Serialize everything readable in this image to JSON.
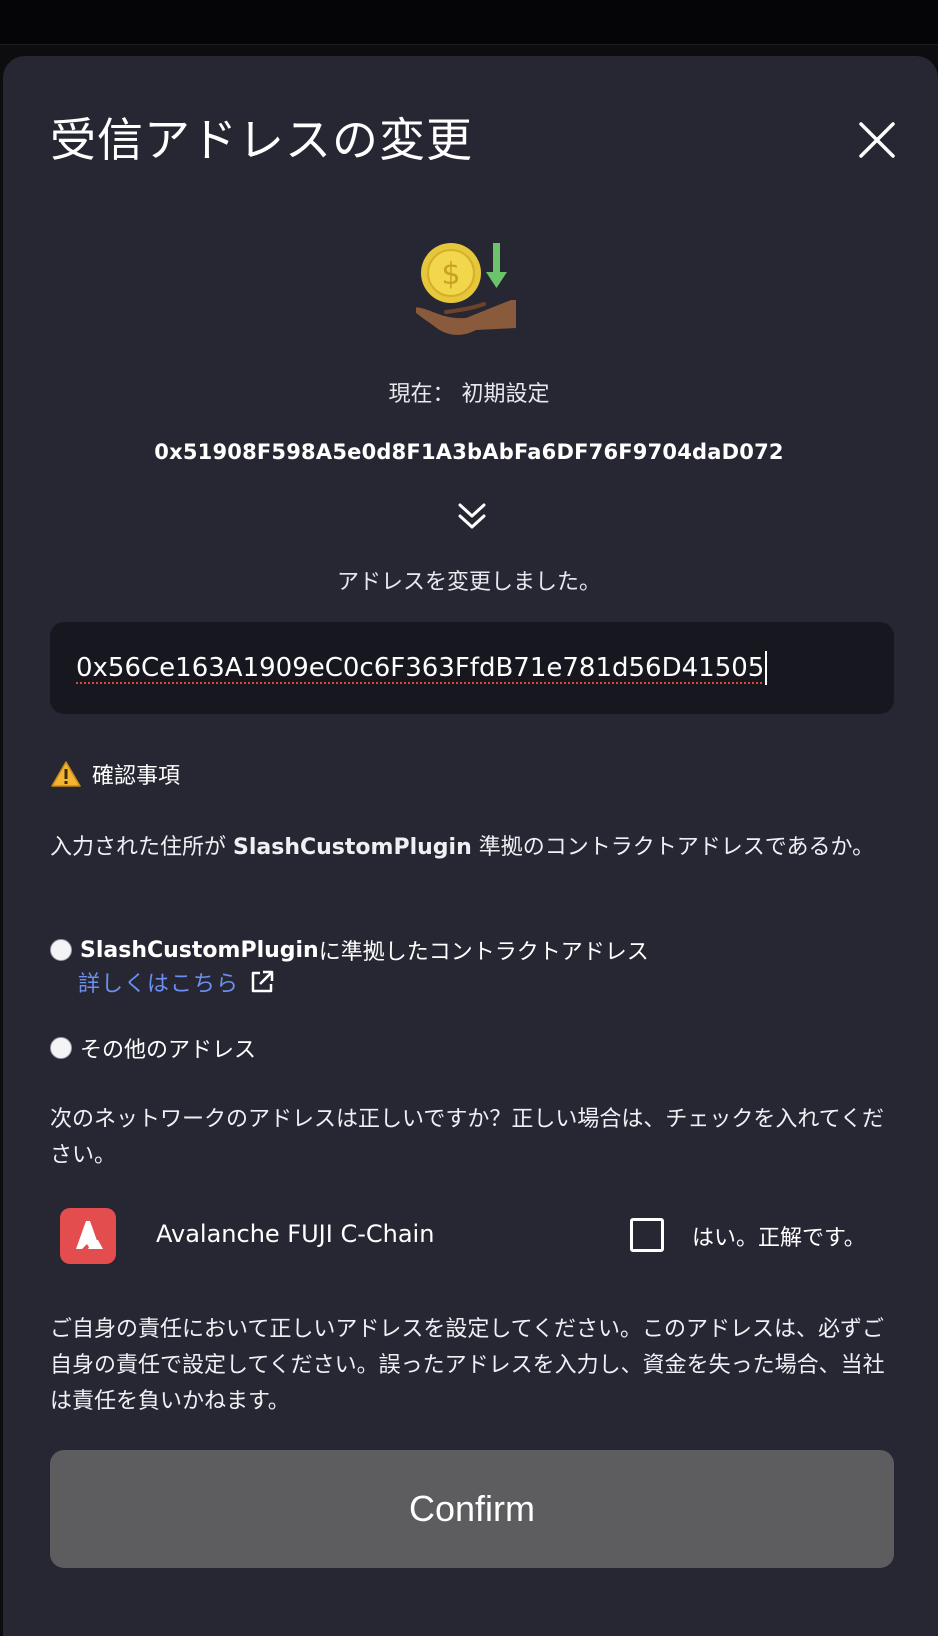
{
  "modal": {
    "title": "受信アドレスの変更",
    "current_label": "現在： 初期設定",
    "current_address": "0x51908F598A5e0d8F1A3bAbFa6DF76F9704daD072",
    "changed_text": "アドレスを変更しました。"
  },
  "address_input": {
    "value": "0x56Ce163A1909eC0c6F363FfdB71e781d56D41505"
  },
  "confirmation": {
    "heading": "確認事項",
    "question_prefix": "入力された住所が",
    "question_brand": "SlashCustomPlugin",
    "question_suffix": "準拠のコントラクトアドレスであるか。",
    "option_plugin_brand": "SlashCustomPlugin",
    "option_plugin_suffix": "に準拠したコントラクトアドレス",
    "learn_more": "詳しくはこちら",
    "option_other": "その他のアドレス",
    "network_question": "次のネットワークのアドレスは正しいですか？正しい場合は、チェックを入れてください。"
  },
  "network": {
    "name": "Avalanche FUJI C-Chain",
    "check_label": "はい。正解です。",
    "checked": false,
    "logo_color": "#e44d4d"
  },
  "disclaimer": "ご自身の責任において正しいアドレスを設定してください。このアドレスは、必ずご自身の責任で設定してください。誤ったアドレスを入力し、資金を失った場合、当社は責任を負いかねます。",
  "confirm_button": {
    "label": "Confirm"
  },
  "colors": {
    "background": "#272733",
    "input_bg": "#17171f",
    "link": "#6b8ff0",
    "button_bg": "#5d5d5f"
  }
}
